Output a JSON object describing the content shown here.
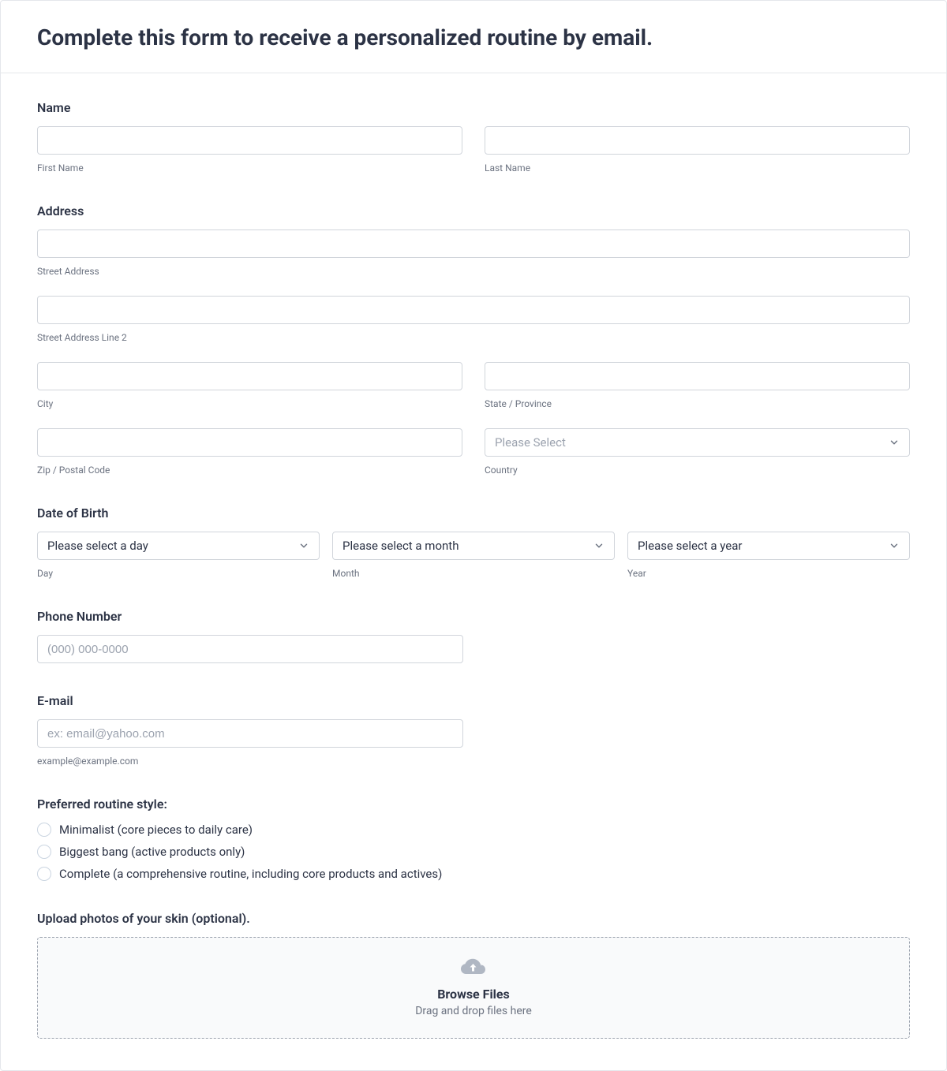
{
  "header": {
    "title": "Complete this form to receive a personalized routine by email."
  },
  "name": {
    "label": "Name",
    "first_sub": "First Name",
    "last_sub": "Last Name"
  },
  "address": {
    "label": "Address",
    "street_sub": "Street Address",
    "street2_sub": "Street Address Line 2",
    "city_sub": "City",
    "state_sub": "State / Province",
    "zip_sub": "Zip / Postal Code",
    "country_sub": "Country",
    "country_placeholder": "Please Select"
  },
  "dob": {
    "label": "Date of Birth",
    "day_placeholder": "Please select a day",
    "month_placeholder": "Please select a month",
    "year_placeholder": "Please select a year",
    "day_sub": "Day",
    "month_sub": "Month",
    "year_sub": "Year"
  },
  "phone": {
    "label": "Phone Number",
    "placeholder": "(000) 000-0000"
  },
  "email": {
    "label": "E-mail",
    "placeholder": "ex: email@yahoo.com",
    "sub": "example@example.com"
  },
  "routine": {
    "label": "Preferred routine style:",
    "options": [
      "Minimalist (core pieces to daily care)",
      "Biggest bang (active products only)",
      "Complete (a comprehensive routine, including core products and actives)"
    ]
  },
  "upload": {
    "label": "Upload photos of your skin (optional).",
    "browse": "Browse Files",
    "dragdrop": "Drag and drop files here"
  }
}
